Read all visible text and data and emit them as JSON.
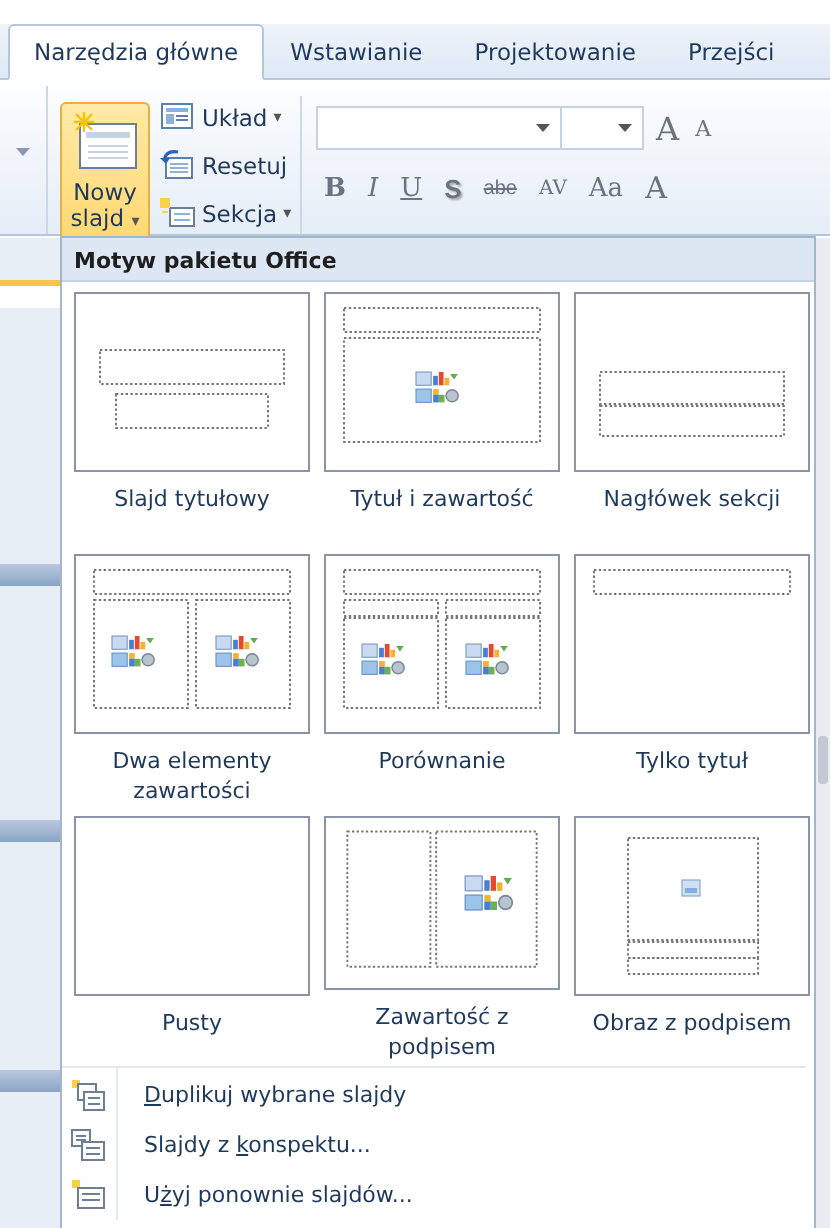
{
  "tabs": [
    {
      "label": "Narzędzia główne",
      "selected": true
    },
    {
      "label": "Wstawianie",
      "selected": false
    },
    {
      "label": "Projektowanie",
      "selected": false
    },
    {
      "label": "Przejści",
      "selected": false
    }
  ],
  "slides_group": {
    "new_slide": {
      "label_line_1": "Nowy",
      "label_line_2": "slajd",
      "caret": "▾",
      "pressed": true
    },
    "small_buttons": [
      {
        "label": "Układ",
        "caret": "▾",
        "kind": "layout"
      },
      {
        "label": "Resetuj",
        "kind": "reset"
      },
      {
        "label": "Sekcja",
        "caret": "▾",
        "kind": "section"
      }
    ]
  },
  "font_group": {
    "grow": "A",
    "shrink": "A",
    "buttons": [
      {
        "label": "B",
        "kind": "bold"
      },
      {
        "label": "I",
        "kind": "italic"
      },
      {
        "label": "U",
        "kind": "underline"
      },
      {
        "label": "S",
        "kind": "shadow"
      },
      {
        "label": "abe",
        "kind": "strike"
      },
      {
        "label": "AV",
        "kind": "spacing"
      },
      {
        "label": "Aa",
        "kind": "case"
      },
      {
        "label": "A",
        "kind": "color"
      }
    ]
  },
  "gallery": {
    "title": "Motyw pakietu Office",
    "layouts": [
      {
        "label": "Slajd tytułowy",
        "kind": "title"
      },
      {
        "label": "Tytuł i zawartość",
        "kind": "title_content"
      },
      {
        "label": "Nagłówek sekcji",
        "kind": "section_header"
      },
      {
        "label": "Dwa elementy zawartości",
        "kind": "two_content"
      },
      {
        "label": "Porównanie",
        "kind": "comparison"
      },
      {
        "label": "Tylko tytuł",
        "kind": "title_only"
      },
      {
        "label": "Pusty",
        "kind": "blank"
      },
      {
        "label": "Zawartość z podpisem",
        "kind": "content_caption"
      },
      {
        "label": "Obraz z podpisem",
        "kind": "picture_caption"
      }
    ]
  },
  "menu_items": [
    {
      "access_key": "D",
      "after": "uplikuj wybrane slajdy",
      "kind": "duplicate"
    },
    {
      "before": "Slajdy z ",
      "access_key": "k",
      "after": "onspektu...",
      "kind": "outline"
    },
    {
      "before": "U",
      "access_key": "ż",
      "after": "yj ponownie slajdów...",
      "kind": "reuse"
    }
  ]
}
